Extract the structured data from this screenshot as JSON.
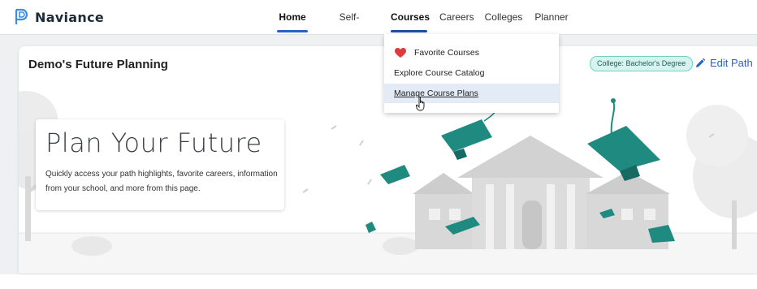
{
  "brand": {
    "name": "Naviance"
  },
  "nav": [
    {
      "label": "Home",
      "active": true
    },
    {
      "label": "Self-Discovery",
      "active": false
    },
    {
      "label": "Courses",
      "active": false
    },
    {
      "label": "Careers",
      "active": false
    },
    {
      "label": "Colleges",
      "active": false
    },
    {
      "label": "Planner",
      "active": false
    }
  ],
  "dropdown": {
    "items": [
      {
        "label": "Favorite Courses",
        "icon": "heart-icon"
      },
      {
        "label": "Explore Course Catalog"
      },
      {
        "label": "Manage Course Plans",
        "highlighted": true
      }
    ]
  },
  "card": {
    "title": "Demo's Future Planning",
    "badge": "College: Bachelor's Degree",
    "edit_label": "Edit Path"
  },
  "hero": {
    "title": "Plan Your Future",
    "description": "Quickly access your path highlights, favorite careers, information from your school, and more from this page."
  },
  "colors": {
    "accent": "#2563c7",
    "teal": "#1f8a80",
    "heart": "#e0393e"
  }
}
